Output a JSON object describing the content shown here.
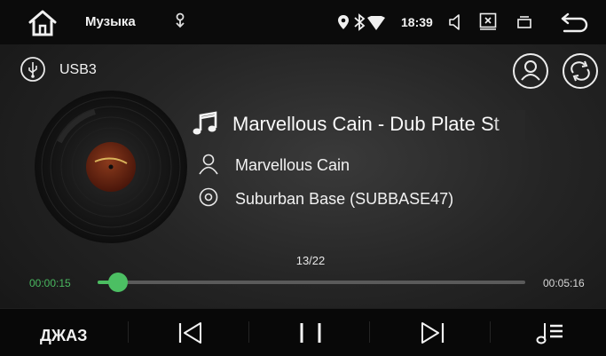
{
  "status_bar": {
    "home_icon": "home-icon",
    "app_title": "Музыка",
    "time": "18:39",
    "icons": [
      "usb-icon",
      "location-icon",
      "bluetooth-icon",
      "wifi-icon",
      "volume-icon",
      "close-window-icon",
      "recent-apps-icon",
      "back-icon"
    ]
  },
  "source": {
    "icon": "usb-icon",
    "label": "USB3"
  },
  "actions": {
    "artist_icon": "person-icon",
    "repeat_icon": "repeat-icon"
  },
  "track": {
    "title": "Marvellous Cain - Dub Plate St",
    "artist": "Marvellous Cain",
    "album": "Suburban Base (SUBBASE47)"
  },
  "playback": {
    "counter": "13/22",
    "elapsed": "00:00:15",
    "total": "00:05:16",
    "progress": 0.048
  },
  "bottom_bar": {
    "eq_label": "ДЖАЗ",
    "controls": [
      "previous-icon",
      "pause-icon",
      "next-icon",
      "playlist-icon"
    ]
  },
  "colors": {
    "accent": "#4cbf63",
    "background": "#252525",
    "bar": "#0b0b0b"
  }
}
